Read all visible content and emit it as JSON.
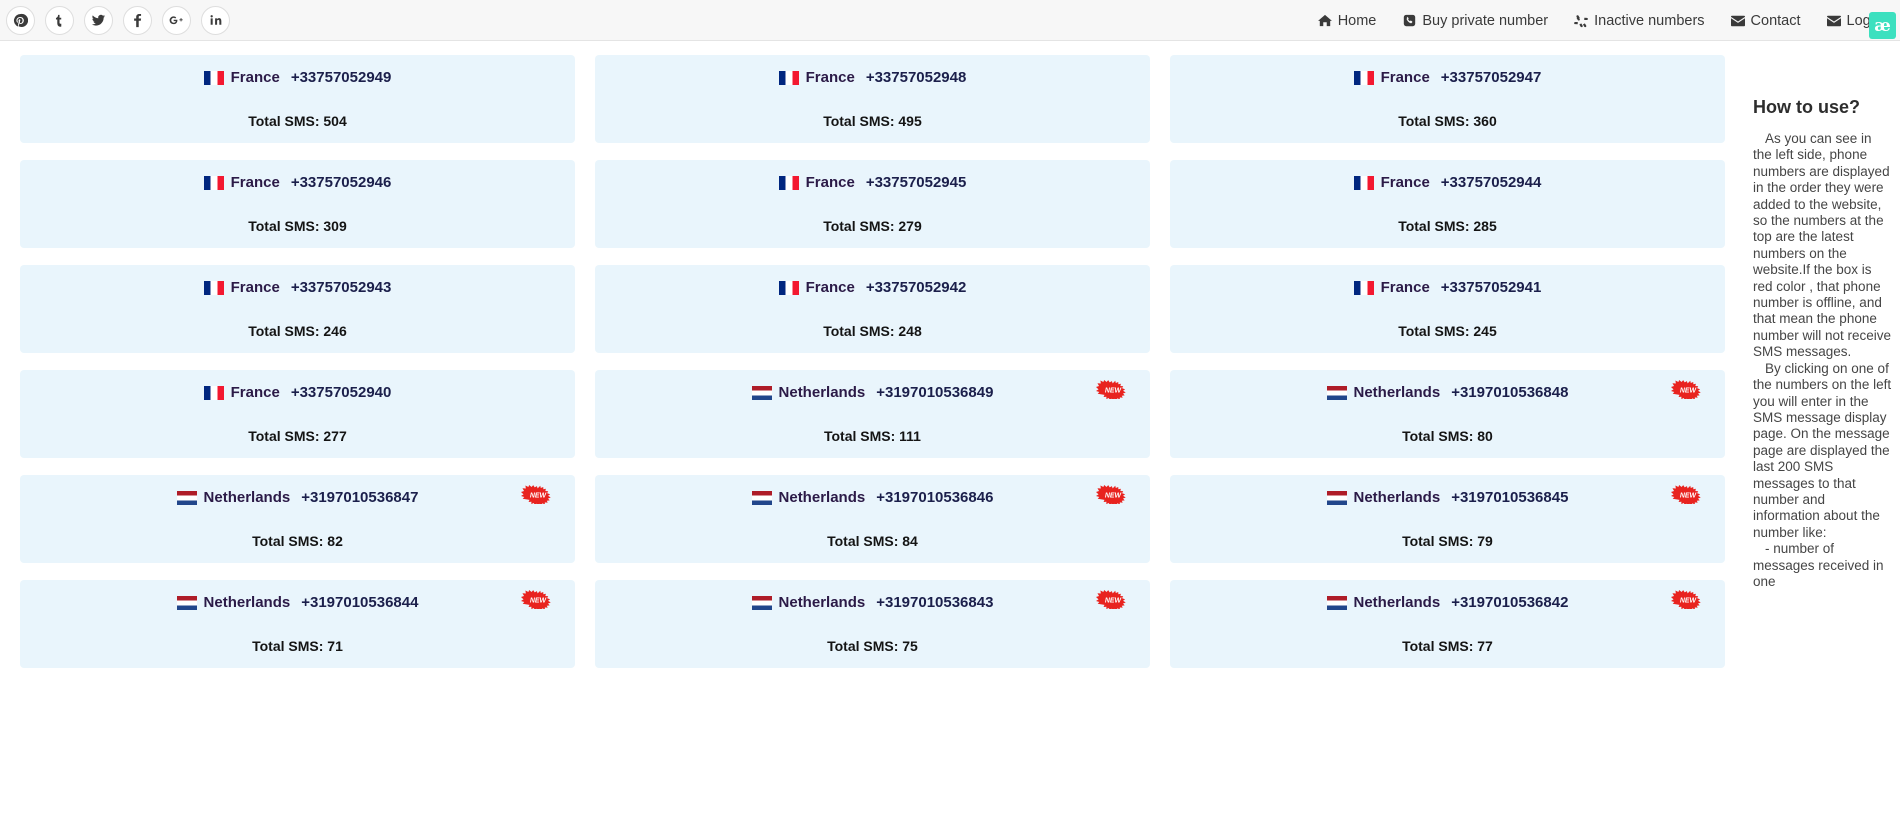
{
  "topbar": {
    "social": [
      {
        "name": "pinterest-icon",
        "glyph": "℗",
        "label": "Pinterest"
      },
      {
        "name": "tumblr-icon",
        "glyph": "t",
        "label": "Tumblr"
      },
      {
        "name": "twitter-icon",
        "glyph": "ᵛ",
        "label": "Twitter"
      },
      {
        "name": "facebook-icon",
        "glyph": "f",
        "label": "Facebook"
      },
      {
        "name": "google-plus-icon",
        "glyph": "8⁺",
        "label": "Google Plus"
      },
      {
        "name": "linkedin-icon",
        "glyph": "in",
        "label": "LinkedIn"
      }
    ],
    "nav": [
      {
        "label": "Home",
        "icon": "home-icon"
      },
      {
        "label": "Buy private number",
        "icon": "phone-icon"
      },
      {
        "label": "Inactive numbers",
        "icon": "recycle-icon"
      },
      {
        "label": "Contact",
        "icon": "envelope-icon"
      },
      {
        "label": "Login",
        "icon": "envelope-icon"
      }
    ],
    "badge_label": "æ",
    "badge_color": "#3ce0bf"
  },
  "numbers": [
    {
      "country": "France",
      "flag": "fr",
      "phone": "+33757052949",
      "sms_label": "Total SMS: 504",
      "is_new": false
    },
    {
      "country": "France",
      "flag": "fr",
      "phone": "+33757052948",
      "sms_label": "Total SMS: 495",
      "is_new": false
    },
    {
      "country": "France",
      "flag": "fr",
      "phone": "+33757052947",
      "sms_label": "Total SMS: 360",
      "is_new": false
    },
    {
      "country": "France",
      "flag": "fr",
      "phone": "+33757052946",
      "sms_label": "Total SMS: 309",
      "is_new": false
    },
    {
      "country": "France",
      "flag": "fr",
      "phone": "+33757052945",
      "sms_label": "Total SMS: 279",
      "is_new": false
    },
    {
      "country": "France",
      "flag": "fr",
      "phone": "+33757052944",
      "sms_label": "Total SMS: 285",
      "is_new": false
    },
    {
      "country": "France",
      "flag": "fr",
      "phone": "+33757052943",
      "sms_label": "Total SMS: 246",
      "is_new": false
    },
    {
      "country": "France",
      "flag": "fr",
      "phone": "+33757052942",
      "sms_label": "Total SMS: 248",
      "is_new": false
    },
    {
      "country": "France",
      "flag": "fr",
      "phone": "+33757052941",
      "sms_label": "Total SMS: 245",
      "is_new": false
    },
    {
      "country": "France",
      "flag": "fr",
      "phone": "+33757052940",
      "sms_label": "Total SMS: 277",
      "is_new": false
    },
    {
      "country": "Netherlands",
      "flag": "nl",
      "phone": "+3197010536849",
      "sms_label": "Total SMS: 111",
      "is_new": true
    },
    {
      "country": "Netherlands",
      "flag": "nl",
      "phone": "+3197010536848",
      "sms_label": "Total SMS: 80",
      "is_new": true
    },
    {
      "country": "Netherlands",
      "flag": "nl",
      "phone": "+3197010536847",
      "sms_label": "Total SMS: 82",
      "is_new": true
    },
    {
      "country": "Netherlands",
      "flag": "nl",
      "phone": "+3197010536846",
      "sms_label": "Total SMS: 84",
      "is_new": true
    },
    {
      "country": "Netherlands",
      "flag": "nl",
      "phone": "+3197010536845",
      "sms_label": "Total SMS: 79",
      "is_new": true
    },
    {
      "country": "Netherlands",
      "flag": "nl",
      "phone": "+3197010536844",
      "sms_label": "Total SMS: 71",
      "is_new": true
    },
    {
      "country": "Netherlands",
      "flag": "nl",
      "phone": "+3197010536843",
      "sms_label": "Total SMS: 75",
      "is_new": true
    },
    {
      "country": "Netherlands",
      "flag": "nl",
      "phone": "+3197010536842",
      "sms_label": "Total SMS: 77",
      "is_new": true
    }
  ],
  "new_badge_label": "NEW",
  "sidebar": {
    "title": "How to use?",
    "paragraph1": "As you can see in the left side, phone numbers are displayed in the order they were added to the website, so the numbers at the top are the latest numbers on the website.If the box is red color , that phone number is offline, and that mean the phone number will not receive SMS messages.",
    "paragraph2": "By clicking on one of the numbers on the left you will enter in the SMS message display page. On the message page are displayed the last 200 SMS messages to that number and information about the number like:",
    "paragraph3": "- number of messages received in one"
  }
}
